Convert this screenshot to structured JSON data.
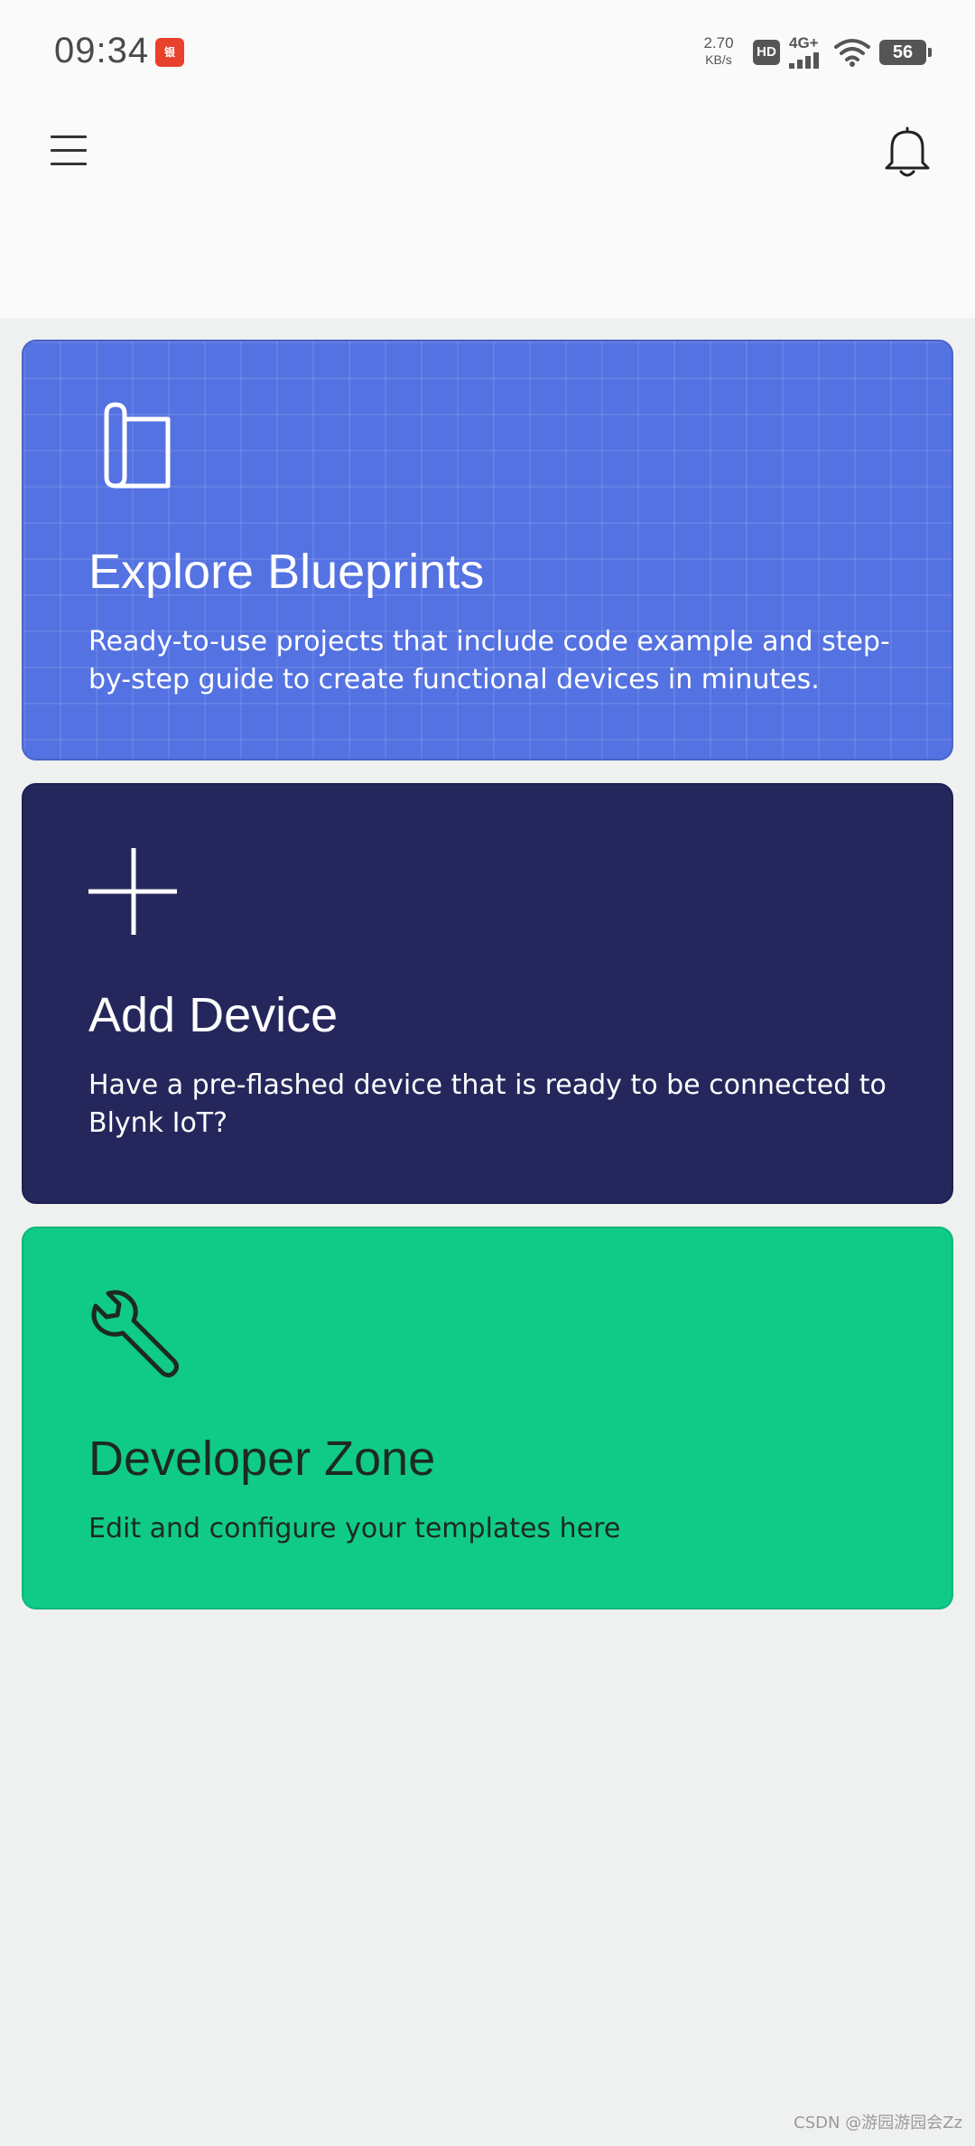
{
  "status_bar": {
    "time": "09:34",
    "app_icon": "bank-app-icon",
    "net_speed_value": "2.70",
    "net_speed_unit": "KB/s",
    "hd_label": "HD",
    "network_type": "4G+",
    "battery_level": "56"
  },
  "app_bar": {
    "menu_icon": "hamburger-menu-icon",
    "notifications_icon": "bell-icon"
  },
  "cards": {
    "blueprints": {
      "icon": "blueprint-scroll-icon",
      "title": "Explore Blueprints",
      "description": "Ready-to-use projects that include code example and step-by-step guide to create functional devices in minutes.",
      "color": "#5472e1"
    },
    "add_device": {
      "icon": "plus-icon",
      "title": "Add Device",
      "description": "Have a pre-flashed device that is ready to be connected to Blynk IoT?",
      "color": "#25275c"
    },
    "developer_zone": {
      "icon": "wrench-icon",
      "title": "Developer Zone",
      "description": "Edit and configure your templates here",
      "color": "#10cb88"
    }
  },
  "watermark": "CSDN @游园游园会Zz"
}
